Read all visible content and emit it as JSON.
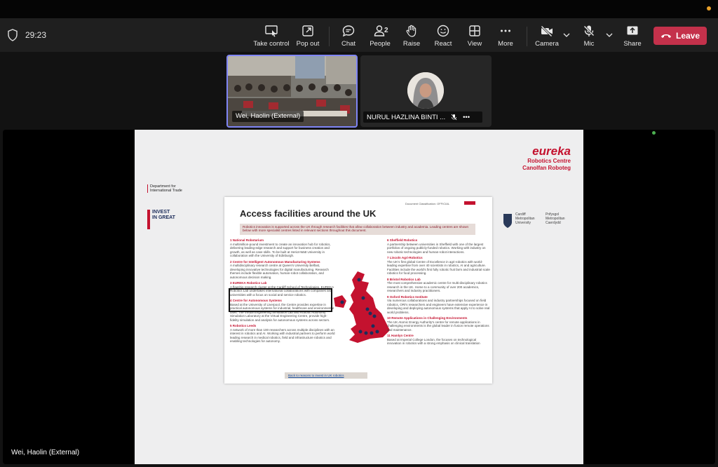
{
  "meeting": {
    "elapsed": "29:23"
  },
  "toolbar": {
    "take_control": "Take control",
    "pop_out": "Pop out",
    "chat": "Chat",
    "people": "People",
    "people_count": "2",
    "raise": "Raise",
    "react": "React",
    "view": "View",
    "more": "More",
    "camera": "Camera",
    "mic": "Mic",
    "share": "Share",
    "leave": "Leave"
  },
  "participants": [
    {
      "name": "Wei, Haolin (External)"
    },
    {
      "name": "NURUL HAZLINA BINTI ..."
    }
  ],
  "presenter": {
    "name": "Wei, Haolin (External)"
  },
  "slide": {
    "brand_title": "eureka",
    "brand_sub1": "Robotics Centre",
    "brand_sub2": "Canolfan Roboteg",
    "dit_text": "Department for International Trade",
    "invest_text": "INVEST IN GREAT",
    "cardiff_text": "Cardiff Metropolitan University",
    "cardiff_cy": "Prifysgol Metropolitan Caerdydd",
    "doc_class": "Document Classification: OFFICIAL",
    "doc_title": "Access facilities around the UK",
    "doc_intro": "Robotics innovation is supported across the UK through research facilities that allow collaboration between industry and academia. Leading centres are shown below with more specialist centres listed in relevant sections throughout this document.",
    "left_items": [
      {
        "heading": "1 National Robotarium",
        "text": "A multimillion-pound investment to create an innovation hub for robotics, delivering leading-edge research and support for business creation and growth, as well as case skills. To be built at Heriot-Watt University in collaboration with the University of Edinburgh."
      },
      {
        "heading": "2 Centre for Intelligent Autonomous Manufacturing Systems",
        "text": "A multidisciplinary research centre at Queen's University Belfast, developing innovative technologies for digital manufacturing. Research themes include flexible automation, human-robot collaboration, and autonomous decision making."
      },
      {
        "heading": "3 EUREKA Robotics Lab",
        "text": "A flagship research cluster at the Cardiff School of Technologies, EUREKA Robotics Lab undertakes international collaborations with companies and universities with a focus on social and service robotics."
      },
      {
        "heading": "4 Centre for Autonomous Systems",
        "text": "Based at the University of Liverpool, the Centre provides expertise in practical autonomous systems for industrial, healthcare and environmental uses. The Virtual Engineering Simulation Lab and Robotic Autonomy Simulation Laboratory at the Virtual Engineering Centre, provide high-fidelity simulation and analysis for autonomous systems across sectors."
      },
      {
        "heading": "5 Robotics Leeds",
        "text": "A network of more than 100 researchers across multiple disciplines with an interest in robotics and AI. Working with industrial partners to perform world leading research in medical robotics, field and infrastructure robotics and enabling technologies for autonomy."
      }
    ],
    "right_items": [
      {
        "heading": "6 Sheffield Robotics",
        "text": "A partnership between universities in Sheffield with one of the largest portfolios of ongoing publicly-funded robotics. Working with industry on new robotic technologies and human-robot interactions."
      },
      {
        "heading": "7 Lincoln Agri-Robotics",
        "text": "The UK's first global Centre of Excellence in agri-robotics with world-leading expertise from over 40 scientists in robotics, AI and agriculture. Facilities include the world's first fully robotic fruit farm and industrial scale robotics for food processing."
      },
      {
        "heading": "8 Bristol Robotics Lab",
        "text": "The most comprehensive academic centre for multi-disciplinary robotics research in the UK. Home to a community of over 200 academics, researchers and industry practitioners."
      },
      {
        "heading": "9 Oxford Robotics Institute",
        "text": "Via numerous collaborations and industry partnerships focused on field robotics, ORI's researchers and engineers have extensive experience in developing and deploying autonomous systems that apply AI to solve real world problems."
      },
      {
        "heading": "10 Remote Applications in Challenging Environments",
        "text": "The UK Atomic Energy Authority's centre for remote applications in challenging environments is the global leader in fusion remote operations and maintenance."
      },
      {
        "heading": "11 Hamlyn Centre",
        "text": "Based at Imperial College London, the focuses on technological innovation in robotics with a strong emphasis on clinical translation"
      }
    ],
    "footer_link": "Back to reasons to invest in UK robotics"
  },
  "colors": {
    "accent": "#7f85f5",
    "leave": "#c4314b",
    "brand_red": "#c4122f"
  }
}
